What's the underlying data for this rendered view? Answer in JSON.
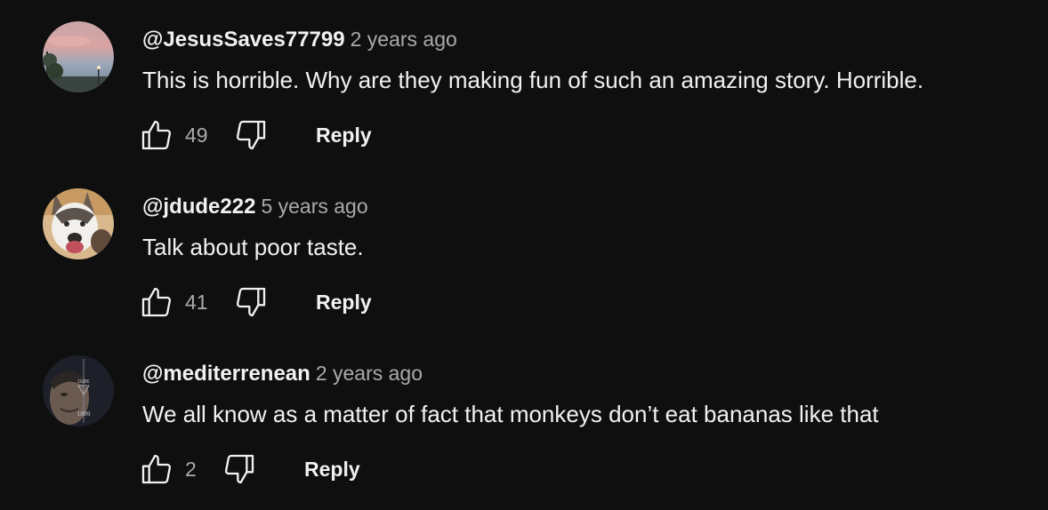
{
  "comments": [
    {
      "author": "@JesusSaves77799",
      "time": "2 years ago",
      "text": "This is horrible.  Why are they making fun of such an amazing story.  Horrible.",
      "likes": "49",
      "reply_label": "Reply",
      "avatar_icon": "sunset-sky-avatar"
    },
    {
      "author": "@jdude222",
      "time": "5 years ago",
      "text": "Talk about poor taste.",
      "likes": "41",
      "reply_label": "Reply",
      "avatar_icon": "husky-dog-avatar"
    },
    {
      "author": "@mediterrenean",
      "time": "2 years ago",
      "text": "We all know as a matter of fact that monkeys don’t eat bananas like that",
      "likes": "2",
      "reply_label": "Reply",
      "avatar_icon": "man-portrait-avatar",
      "avatar_text": [
        "OLEK",
        "1899"
      ]
    }
  ],
  "colors": {
    "background": "#0f0f0f",
    "primary_text": "#f1f1f1",
    "secondary_text": "#aaaaaa"
  }
}
